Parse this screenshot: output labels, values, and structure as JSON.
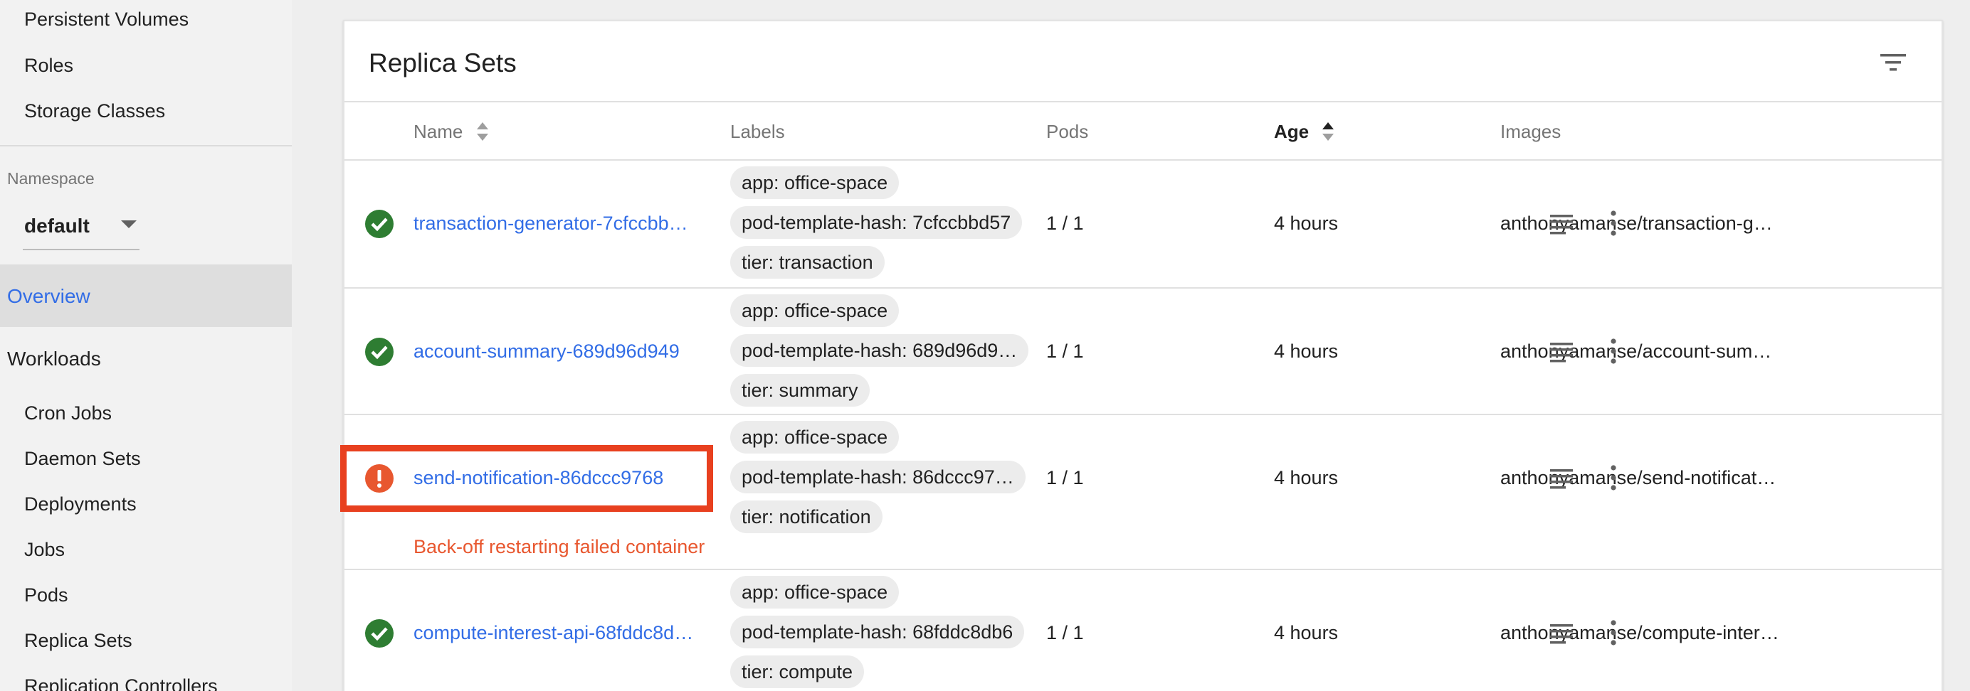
{
  "sidebar": {
    "items_top": [
      "Persistent Volumes",
      "Roles",
      "Storage Classes"
    ],
    "namespace_label": "Namespace",
    "namespace_value": "default",
    "overview": "Overview",
    "workloads": "Workloads",
    "workload_items": [
      "Cron Jobs",
      "Daemon Sets",
      "Deployments",
      "Jobs",
      "Pods",
      "Replica Sets",
      "Replication Controllers"
    ]
  },
  "card": {
    "title": "Replica Sets",
    "columns": {
      "name": "Name",
      "labels": "Labels",
      "pods": "Pods",
      "age": "Age",
      "images": "Images"
    },
    "rows": [
      {
        "status": "ok",
        "name": "transaction-generator-7cfccbb…",
        "labels": [
          "app: office-space",
          "pod-template-hash: 7cfccbbd57",
          "tier: transaction"
        ],
        "pods": "1 / 1",
        "age": "4 hours",
        "image": "anthonyamanse/transaction-g…"
      },
      {
        "status": "ok",
        "name": "account-summary-689d96d949",
        "labels": [
          "app: office-space",
          "pod-template-hash: 689d96d9…",
          "tier: summary"
        ],
        "pods": "1 / 1",
        "age": "4 hours",
        "image": "anthonyamanse/account-sum…"
      },
      {
        "status": "error",
        "name": "send-notification-86dccc9768",
        "labels": [
          "app: office-space",
          "pod-template-hash: 86dccc97…",
          "tier: notification"
        ],
        "pods": "1 / 1",
        "age": "4 hours",
        "image": "anthonyamanse/send-notificat…",
        "error": "Back-off restarting failed container"
      },
      {
        "status": "ok",
        "name": "compute-interest-api-68fddc8d…",
        "labels": [
          "app: office-space",
          "pod-template-hash: 68fddc8db6",
          "tier: compute"
        ],
        "pods": "1 / 1",
        "age": "4 hours",
        "image": "anthonyamanse/compute-inter…"
      }
    ]
  },
  "colors": {
    "accent": "#326de6",
    "ok": "#2e7d32",
    "error": "#e8572f",
    "highlight": "#e8401f"
  }
}
